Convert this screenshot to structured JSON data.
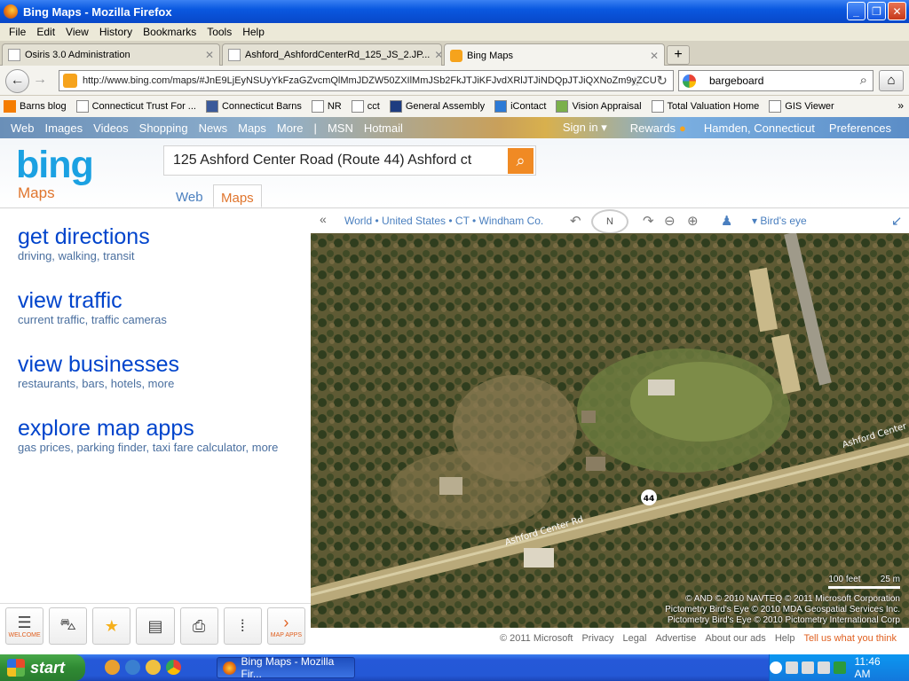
{
  "window": {
    "title": "Bing Maps - Mozilla Firefox"
  },
  "menu": [
    "File",
    "Edit",
    "View",
    "History",
    "Bookmarks",
    "Tools",
    "Help"
  ],
  "tabs": [
    {
      "label": "Osiris 3.0 Administration"
    },
    {
      "label": "Ashford_AshfordCenterRd_125_JS_2.JP..."
    },
    {
      "label": "Bing Maps"
    }
  ],
  "nav": {
    "url": "http://www.bing.com/maps/#JnE9LjEyNSUyYkFzaGZvcmQlMmJDZW50ZXIlMmJSb2FkJTJiKFJvdXRlJTJiNDQpJTJiQXNoZm9yZCU",
    "search": "bargeboard"
  },
  "bookmarks": [
    "Barns blog",
    "Connecticut Trust For ...",
    "Connecticut Barns",
    "NR",
    "cct",
    "General Assembly",
    "iContact",
    "Vision Appraisal",
    "Total Valuation Home",
    "GIS Viewer"
  ],
  "bing": {
    "topnav": [
      "Web",
      "Images",
      "Videos",
      "Shopping",
      "News",
      "Maps",
      "More",
      "|",
      "MSN",
      "Hotmail"
    ],
    "signin": "Sign in ▾",
    "rewards": "Rewards",
    "location": "Hamden, Connecticut",
    "preferences": "Preferences",
    "logo": "bing",
    "section": "Maps",
    "query": "125 Ashford Center Road (Route 44) Ashford ct",
    "tabs": [
      "Web",
      "Maps"
    ]
  },
  "tasks": [
    {
      "title": "get directions",
      "sub": "driving, walking, transit"
    },
    {
      "title": "view traffic",
      "sub": "current traffic, traffic cameras"
    },
    {
      "title": "view businesses",
      "sub": "restaurants, bars, hotels, more"
    },
    {
      "title": "explore map apps",
      "sub": "gas prices, parking finder, taxi fare calculator, more"
    }
  ],
  "tools": [
    {
      "label": "WELCOME",
      "icon": "list-icon"
    },
    {
      "label": "",
      "icon": "car-icon"
    },
    {
      "label": "",
      "icon": "star-icon"
    },
    {
      "label": "",
      "icon": "card-icon"
    },
    {
      "label": "",
      "icon": "printer-icon"
    },
    {
      "label": "",
      "icon": "traffic-light-icon"
    },
    {
      "label": "MAP APPS",
      "icon": "chevron-right-icon"
    }
  ],
  "map": {
    "breadcrumb": "World • United States • CT • Windham Co.",
    "view": "Bird's eye",
    "road_labels": [
      "Ashford Center Rd",
      "Ashford Center",
      "44"
    ],
    "scale": [
      "100 feet",
      "25 m"
    ],
    "attribution": [
      "© AND  © 2010 NAVTEQ  © 2011 Microsoft Corporation",
      "Pictometry Bird's Eye © 2010 MDA Geospatial Services Inc.",
      "Pictometry Bird's Eye © 2010 Pictometry International Corp"
    ]
  },
  "footer": [
    "© 2011 Microsoft",
    "Privacy",
    "Legal",
    "Advertise",
    "About our ads",
    "Help",
    "Tell us what you think"
  ],
  "taskbar": {
    "start": "start",
    "item": "Bing Maps - Mozilla Fir...",
    "clock": "11:46 AM"
  }
}
